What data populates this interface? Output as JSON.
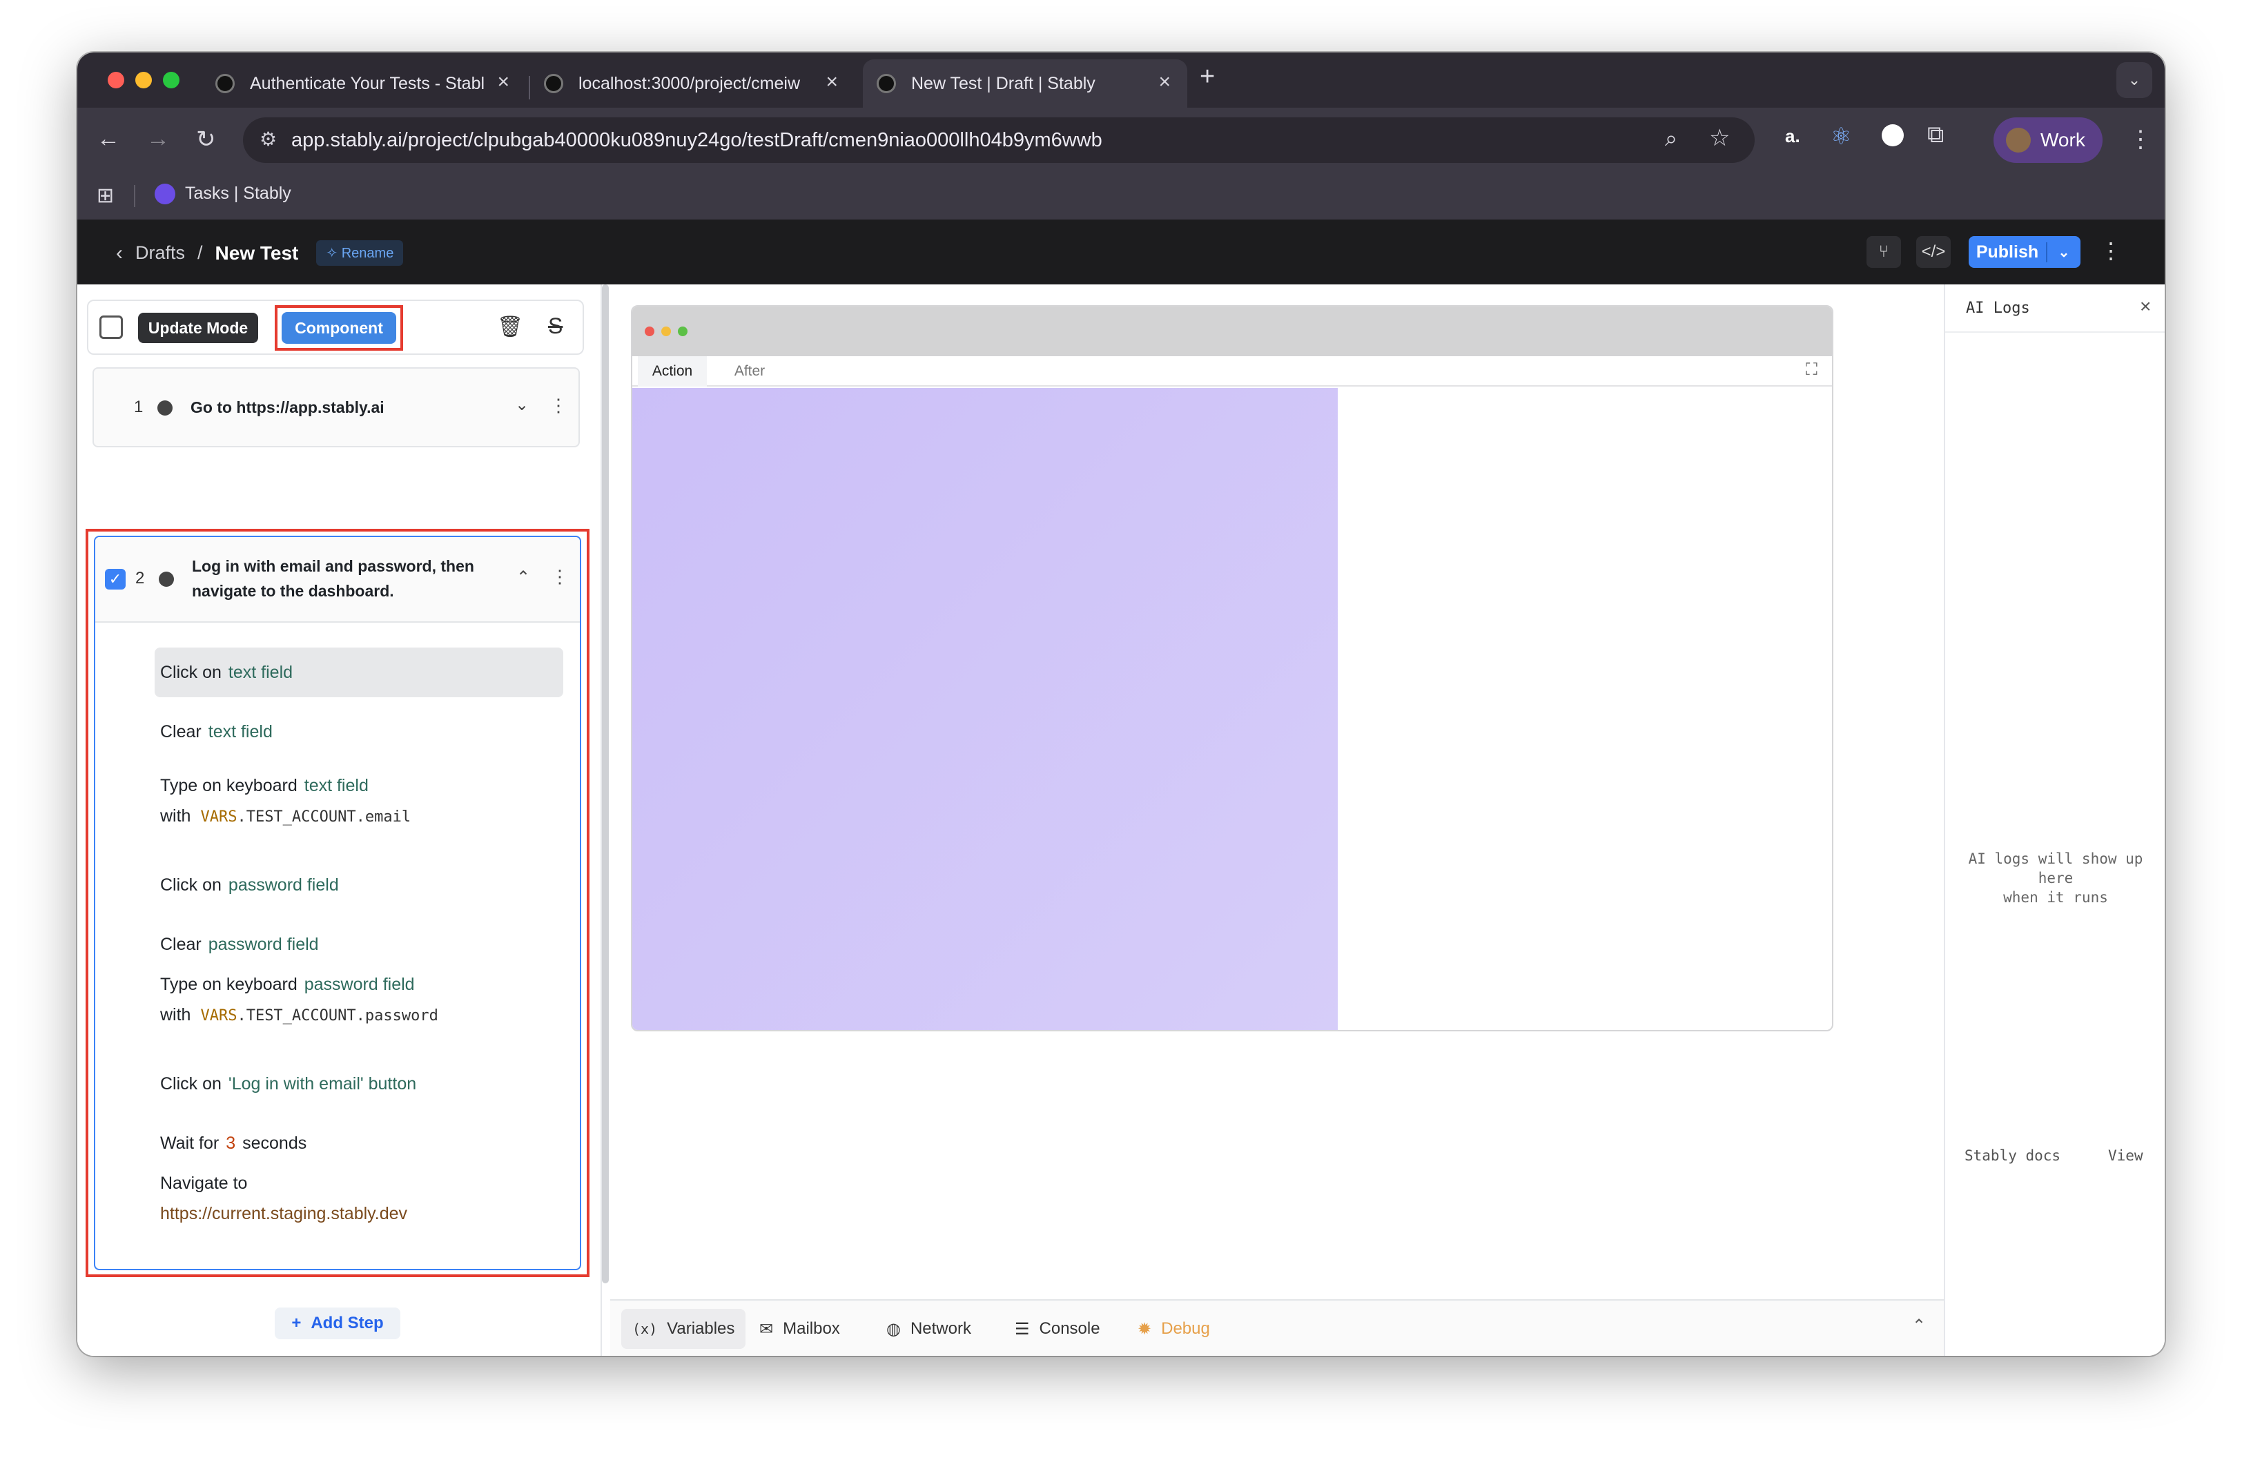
{
  "browser": {
    "tabs": [
      {
        "title": "Authenticate Your Tests - Stabl",
        "active": false
      },
      {
        "title": "localhost:3000/project/cmeiw",
        "active": false
      },
      {
        "title": "New Test | Draft | Stably",
        "active": true
      }
    ],
    "new_tab": "+",
    "url": "app.stably.ai/project/clpubgab40000ku089nuy24go/testDraft/cmen9niao000llh04b9ym6wwb",
    "profile": "Work",
    "ext_a": "a.",
    "bookmark": "Tasks | Stably"
  },
  "header": {
    "back": "‹",
    "crumb_parent": "Drafts",
    "separator": "/",
    "title": "New Test",
    "rename": "Rename",
    "publish": "Publish"
  },
  "toolbar": {
    "update_mode": "Update Mode",
    "component": "Component"
  },
  "steps": [
    {
      "number": "1",
      "title": "Go to https://app.stably.ai"
    },
    {
      "number": "2",
      "title_line1": "Log in with email and password, then",
      "title_line2": "navigate to the dashboard."
    }
  ],
  "actions": {
    "a1": {
      "verb": "Click on",
      "target": "text field"
    },
    "a2": {
      "verb": "Clear",
      "target": "text field"
    },
    "a3": {
      "verb": "Type on keyboard",
      "target": "text field",
      "with": "with",
      "var_prefix": "VARS",
      "var_rest": ".TEST_ACCOUNT.email"
    },
    "a4": {
      "verb": "Click on",
      "target": "password field"
    },
    "a5": {
      "verb": "Clear",
      "target": "password field"
    },
    "a6": {
      "verb": "Type on keyboard",
      "target": "password field",
      "with": "with",
      "var_prefix": "VARS",
      "var_rest": ".TEST_ACCOUNT.password"
    },
    "a7": {
      "verb": "Click on",
      "target": "'Log in with email' button"
    },
    "a8": {
      "verb": "Wait for",
      "number": "3",
      "unit": "seconds"
    },
    "a9": {
      "verb": "Navigate to",
      "url": "https://current.staging.stably.dev"
    }
  },
  "add_step": "Add Step",
  "preview": {
    "tab_action": "Action",
    "tab_after": "After"
  },
  "bottom_tabs": {
    "variables_icon": "(x)",
    "variables": "Variables",
    "mailbox": "Mailbox",
    "network": "Network",
    "console": "Console",
    "debug": "Debug"
  },
  "ai_logs": {
    "title": "AI Logs",
    "empty_line1": "AI logs will show up here",
    "empty_line2": "when it runs",
    "docs": "Stably docs",
    "view": "View"
  },
  "colors": {
    "accent": "#3b82f6",
    "highlight_box": "#e53b2f",
    "preview_fill": "#cbbff8"
  }
}
